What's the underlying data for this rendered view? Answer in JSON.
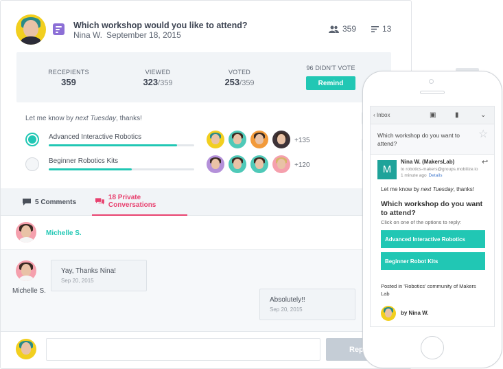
{
  "post": {
    "title": "Which workshop would you like to attend?",
    "author": "Nina W.",
    "date": "September 18, 2015",
    "participants": "359",
    "responses": "13"
  },
  "stats": {
    "recipients_label": "RECEPIENTS",
    "recipients_value": "359",
    "viewed_label": "VIEWED",
    "viewed_value": "323",
    "viewed_total": "/359",
    "voted_label": "VOTED",
    "voted_value": "253",
    "voted_total": "/359",
    "didnt_vote_label": "96 DIDN'T VOTE",
    "remind_button": "Remind"
  },
  "poll": {
    "intro_prefix": "Let me know by ",
    "intro_emphasis": "next Tuesday",
    "intro_suffix": ", thanks!",
    "options": [
      {
        "label": "Advanced Interactive Robotics",
        "fraction": 0.88,
        "more": "+135",
        "selected": true
      },
      {
        "label": "Beginner Robotics Kits",
        "fraction": 0.57,
        "more": "+120",
        "selected": false
      }
    ]
  },
  "tabs": {
    "comments": "5 Comments",
    "private": "18 Private Conversations"
  },
  "conversation": {
    "name": "Michelle S.",
    "messages": [
      {
        "text": "Yay, Thanks Nina!",
        "date": "Sep 20, 2015",
        "sender": "Michelle S."
      },
      {
        "text": "Absolutely!!",
        "date": "Sep 20, 2015"
      }
    ],
    "reply_button": "Reply"
  },
  "email": {
    "inbox_label": "Inbox",
    "subject": "Which workshop do you want to attend?",
    "avatar_letter": "M",
    "from": "Nina W. (MakersLab)",
    "to": "to robotics-makers@groups.mobilize.io",
    "time": "1 minute ago",
    "details_link": "Details",
    "intro_prefix": "Let me know by ",
    "intro_emphasis": "next Tuesday",
    "intro_suffix": ", thanks!",
    "question": "Which workshop do you want to attend?",
    "hint": "Click on one of the options to reply:",
    "option_1": "Advanced Interactive Robotics",
    "option_2": "Beginner Robot Kits",
    "posted": "Posted in 'Robotics' community of Makers Lab",
    "by": "by Nina W."
  },
  "colors": {
    "accent": "#21c7b4",
    "private_tab": "#e8416f",
    "poll_icon": "#8c6fd6"
  }
}
